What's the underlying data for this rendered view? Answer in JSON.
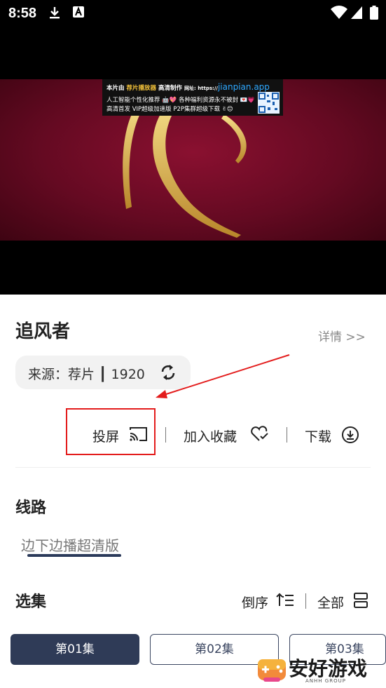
{
  "status_bar": {
    "time": "8:58"
  },
  "video": {
    "watermark": {
      "prefix": "本片由",
      "app_name": "荐片播放器",
      "suffix": "高清制作",
      "site_label": "网址: https://",
      "url": "jianpian.app",
      "line2": "人工智能个性化推荐 🤖💖 各种福利资源永不被封 💌💗",
      "line3": "高清首发 VIP超级加速版 P2P集群超级下载 ✌😊"
    }
  },
  "detail": {
    "title": "追风者",
    "detail_link": "详情 >>",
    "source": "来源：荐片 ┃ 1920"
  },
  "actions": {
    "cast": "投屏",
    "favorite": "加入收藏",
    "download": "下载"
  },
  "route": {
    "heading": "线路",
    "items": [
      "边下边播超清版"
    ]
  },
  "episodes": {
    "heading": "选集",
    "sort": "倒序",
    "all": "全部",
    "items": [
      "第01集",
      "第02集",
      "第03集"
    ]
  },
  "logo": {
    "text": "安好游戏",
    "sub": "ANHH GROUP"
  },
  "colors": {
    "accent": "#2f3b57",
    "annotation": "#e31c1c"
  }
}
